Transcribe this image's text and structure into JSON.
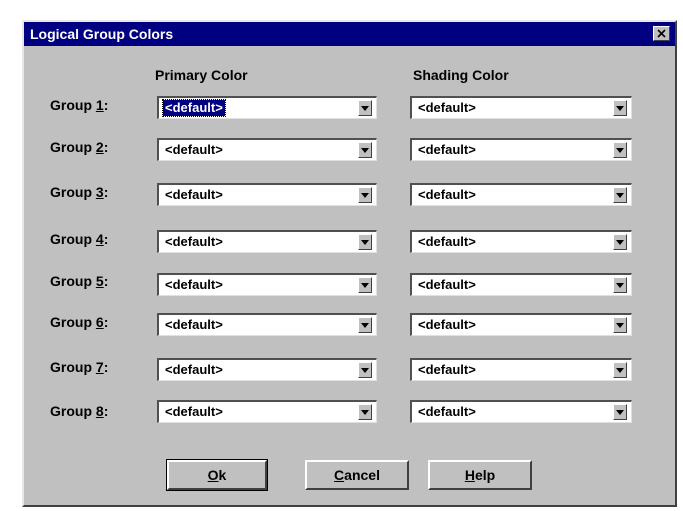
{
  "window": {
    "title": "Logical Group Colors"
  },
  "headers": {
    "primary": "Primary Color",
    "shading": "Shading Color"
  },
  "groups": [
    {
      "prefix": "Group ",
      "num": "1",
      "suffix": ":",
      "primary": "<default>",
      "shading": "<default>"
    },
    {
      "prefix": "Group ",
      "num": "2",
      "suffix": ":",
      "primary": "<default>",
      "shading": "<default>"
    },
    {
      "prefix": "Group ",
      "num": "3",
      "suffix": ":",
      "primary": "<default>",
      "shading": "<default>"
    },
    {
      "prefix": "Group ",
      "num": "4",
      "suffix": ":",
      "primary": "<default>",
      "shading": "<default>"
    },
    {
      "prefix": "Group ",
      "num": "5",
      "suffix": ":",
      "primary": "<default>",
      "shading": "<default>"
    },
    {
      "prefix": "Group ",
      "num": "6",
      "suffix": ":",
      "primary": "<default>",
      "shading": "<default>"
    },
    {
      "prefix": "Group ",
      "num": "7",
      "suffix": ":",
      "primary": "<default>",
      "shading": "<default>"
    },
    {
      "prefix": "Group ",
      "num": "8",
      "suffix": ":",
      "primary": "<default>",
      "shading": "<default>"
    }
  ],
  "buttons": {
    "ok": {
      "mnemonic": "O",
      "rest": "k"
    },
    "cancel": {
      "mnemonic": "C",
      "rest": "ancel"
    },
    "help": {
      "mnemonic": "H",
      "rest": "elp"
    }
  },
  "colors": {
    "titlebar": "#000080",
    "face": "#c0c0c0",
    "selection": "#000080"
  }
}
